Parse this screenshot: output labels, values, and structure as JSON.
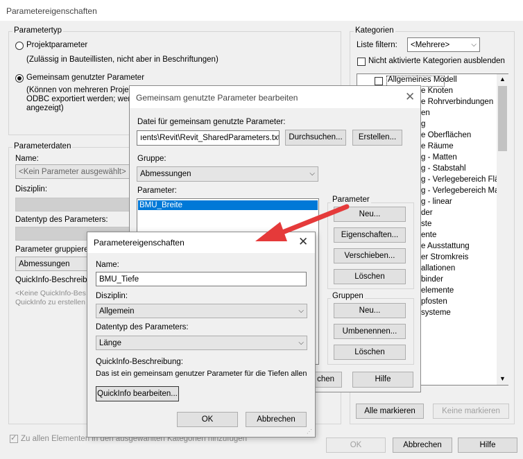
{
  "main_dialog": {
    "title": "Parametereigenschaften",
    "parametertyp": {
      "label": "Parametertyp",
      "projekt": "Projektparameter",
      "projekt_hint": "(Zulässig in Bauteillisten, nicht aber in Beschriftungen)",
      "shared": "Gemeinsam genutzter Parameter",
      "shared_hint1": "(Können von mehreren Projekt",
      "shared_hint2": "ODBC exportiert werden; werd",
      "shared_hint3": "angezeigt)"
    },
    "parameterdaten": {
      "label": "Parameterdaten",
      "name_label": "Name:",
      "name_value": "<Kein Parameter ausgewählt>",
      "disziplin_label": "Disziplin:",
      "datentyp_label": "Datentyp des Parameters:",
      "gruppieren_label": "Parameter gruppieren",
      "gruppieren_value": "Abmessungen",
      "quickinfo_label": "QuickInfo-Beschreibu",
      "quickinfo_text1": "<Keine QuickInfo-Bes",
      "quickinfo_text2": "QuickInfo zu erstellen"
    },
    "kategorien": {
      "label": "Kategorien",
      "filter_label": "Liste filtern:",
      "filter_value": "<Mehrere>",
      "hide_label": "Nicht aktivierte Kategorien ausblenden",
      "items": [
        "Allgemeines Modell",
        "e Knoten",
        "e Rohrverbindungen",
        "en",
        "g",
        "e Oberflächen",
        "e Räume",
        "g - Matten",
        "g - Stabstahl",
        "g - Verlegebereich Flä...",
        "g - Verlegebereich Mat...",
        "g - linear",
        "der",
        "ste",
        "ente",
        "e Ausstattung",
        "er Stromkreis",
        "allationen",
        "binder",
        "elemente",
        "pfosten",
        "systeme"
      ],
      "alle_markieren": "Alle markieren",
      "keine_markieren": "Keine markieren"
    },
    "apply_all": "Zu allen Elementen in den ausgewählten Kategorien hinzufügen",
    "ok": "OK",
    "abbrechen": "Abbrechen",
    "hilfe": "Hilfe"
  },
  "shared_dialog": {
    "title": "Gemeinsam genutzte Parameter bearbeiten",
    "file_label": "Datei für gemeinsam genutzte Parameter:",
    "file_value": "ıents\\Revit\\Revit_SharedParameters.txt",
    "durchsuchen": "Durchsuchen...",
    "erstellen": "Erstellen...",
    "gruppe_label": "Gruppe:",
    "gruppe_value": "Abmessungen",
    "parameter_label": "Parameter:",
    "parameter_items": [
      "BMU_Breite"
    ],
    "param_group": {
      "label": "Parameter",
      "neu": "Neu...",
      "eigenschaften": "Eigenschaften...",
      "verschieben": "Verschieben...",
      "loeschen": "Löschen"
    },
    "gruppen_group": {
      "label": "Gruppen",
      "neu": "Neu...",
      "umbenennen": "Umbenennen...",
      "loeschen": "Löschen"
    },
    "abbrechen_partial": "chen",
    "hilfe": "Hilfe"
  },
  "front_dialog": {
    "title": "Parametereigenschaften",
    "name_label": "Name:",
    "name_value": "BMU_Tiefe",
    "disziplin_label": "Disziplin:",
    "disziplin_value": "Allgemein",
    "datentyp_label": "Datentyp des Parameters:",
    "datentyp_value": "Länge",
    "quickinfo_label": "QuickInfo-Beschreibung:",
    "quickinfo_text": "Das ist ein gemeinsam genutzer Parameter für die Tiefen allen",
    "quickinfo_button": "QuickInfo bearbeiten...",
    "ok": "OK",
    "abbrechen": "Abbrechen"
  },
  "colors": {
    "arrow": "#e53a3a",
    "selection": "#0078d7",
    "focus_border": "#0078d7"
  }
}
